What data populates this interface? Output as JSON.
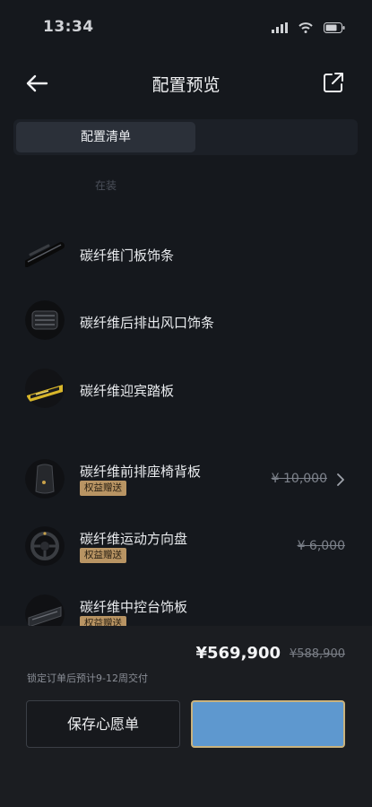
{
  "status_bar": {
    "time": "13:34"
  },
  "header": {
    "title": "配置预览"
  },
  "tabs": {
    "active_label": "配置清单"
  },
  "section_label": "在装",
  "items": [
    {
      "name": "碳纤维门板饰条"
    },
    {
      "name": "碳纤维后排出风口饰条"
    },
    {
      "name": "碳纤维迎宾踏板"
    },
    {
      "name": "碳纤维前排座椅背板",
      "badge": "权益赠送",
      "original_price": "¥ 10,000"
    },
    {
      "name": "碳纤维运动方向盘",
      "badge": "权益赠送",
      "original_price": "¥ 6,000"
    },
    {
      "name": "碳纤维中控台饰板",
      "badge": "权益赠送"
    }
  ],
  "summary": {
    "total_price": "¥569,900",
    "original_price": "¥588,900",
    "delivery_note": "锁定订单后预计9-12周交付"
  },
  "actions": {
    "wishlist_label": "保存心愿单"
  },
  "colors": {
    "accent_blue": "#5e98cf",
    "badge_gold": "#b89463",
    "background": "#15181d"
  }
}
